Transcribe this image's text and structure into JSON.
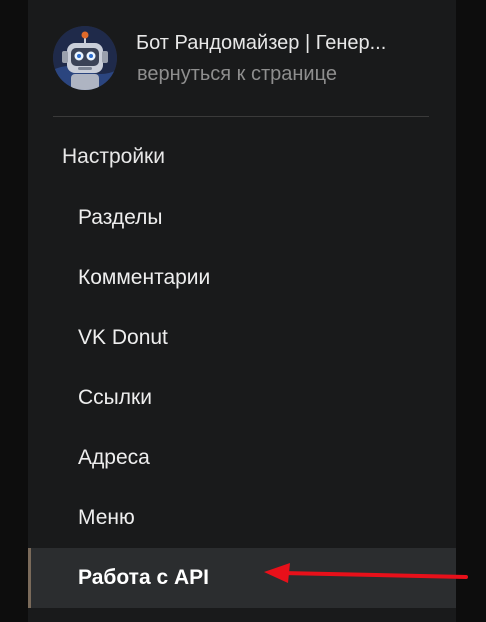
{
  "header": {
    "title": "Бот Рандомайзер | Генер...",
    "back_link": "вернуться к странице",
    "avatar_icon": "robot-icon"
  },
  "menu": {
    "section_title": "Настройки",
    "items": [
      {
        "label": "Разделы",
        "active": false
      },
      {
        "label": "Комментарии",
        "active": false
      },
      {
        "label": "VK Donut",
        "active": false
      },
      {
        "label": "Ссылки",
        "active": false
      },
      {
        "label": "Адреса",
        "active": false
      },
      {
        "label": "Меню",
        "active": false
      },
      {
        "label": "Работа с API",
        "active": true
      }
    ]
  },
  "annotation": {
    "arrow_color": "#e8101a"
  }
}
